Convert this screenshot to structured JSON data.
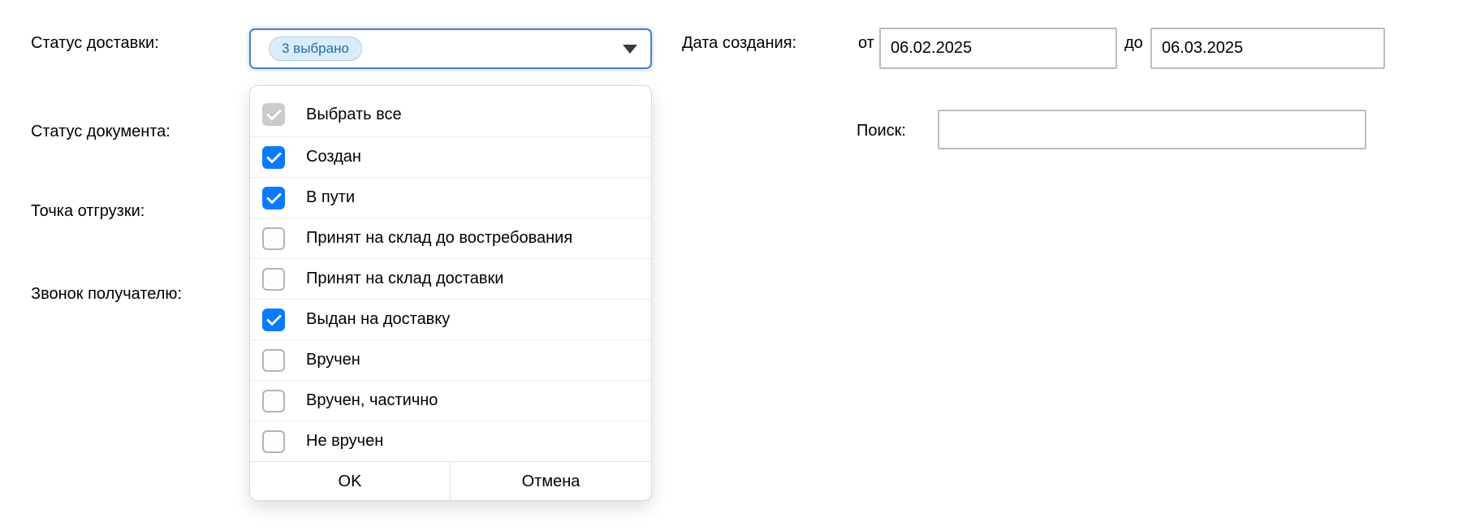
{
  "filters": {
    "delivery_status": {
      "label": "Статус доставки:",
      "badge": "3 выбрано",
      "options": [
        {
          "label": "Выбрать все",
          "state": "partial"
        },
        {
          "label": "Создан",
          "state": "checked"
        },
        {
          "label": "В пути",
          "state": "checked"
        },
        {
          "label": "Принят на склад до востребования",
          "state": "unchecked"
        },
        {
          "label": "Принят на склад доставки",
          "state": "unchecked"
        },
        {
          "label": "Выдан на доставку",
          "state": "checked"
        },
        {
          "label": "Вручен",
          "state": "unchecked"
        },
        {
          "label": "Вручен, частично",
          "state": "unchecked"
        },
        {
          "label": "Не вручен",
          "state": "unchecked"
        }
      ],
      "ok_label": "OK",
      "cancel_label": "Отмена"
    },
    "document_status": {
      "label": "Статус документа:"
    },
    "shipping_point": {
      "label": "Точка отгрузки:"
    },
    "recipient_call": {
      "label": "Звонок получателю:"
    },
    "creation_date": {
      "label": "Дата создания:",
      "from_label": "от",
      "from_value": "06.02.2025",
      "to_label": "до",
      "to_value": "06.03.2025"
    },
    "search": {
      "label": "Поиск:",
      "value": ""
    }
  },
  "colors": {
    "checkbox_checked": "#0a7aff",
    "checkbox_partial": "#cbcbcb",
    "dropdown_border": "#4d7fc4",
    "badge_bg": "#daecfb",
    "badge_border": "#abcdea",
    "badge_text": "#1f6da6"
  }
}
